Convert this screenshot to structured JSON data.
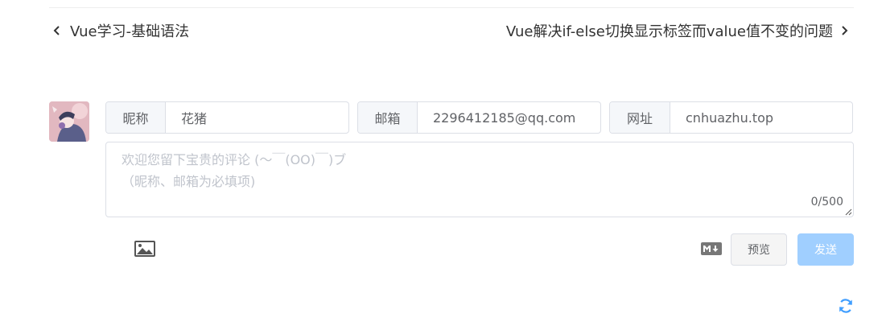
{
  "post_nav": {
    "prev_title": "Vue学习-基础语法",
    "next_title": "Vue解决if-else切换显示标签而value值不变的问题"
  },
  "comment_form": {
    "nickname": {
      "label": "昵称",
      "value": "花猪"
    },
    "email": {
      "label": "邮箱",
      "value": "2296412185@qq.com"
    },
    "website": {
      "label": "网址",
      "value": "cnhuazhu.top"
    },
    "textarea_placeholder": "欢迎您留下宝贵的评论 (～￣(OO)￣)ブ\n（昵称、邮箱为必填项)",
    "counter": "0/500",
    "preview_label": "预览",
    "send_label": "发送"
  },
  "icons": {
    "prev": "chevron-left-icon",
    "next": "chevron-right-icon",
    "image_upload": "image-icon",
    "markdown": "markdown-icon",
    "refresh": "refresh-icon"
  },
  "colors": {
    "send_button": "#a0cfff",
    "refresh_icon": "#409eff",
    "border": "#dcdfe6",
    "placeholder": "#c0c4cc"
  }
}
